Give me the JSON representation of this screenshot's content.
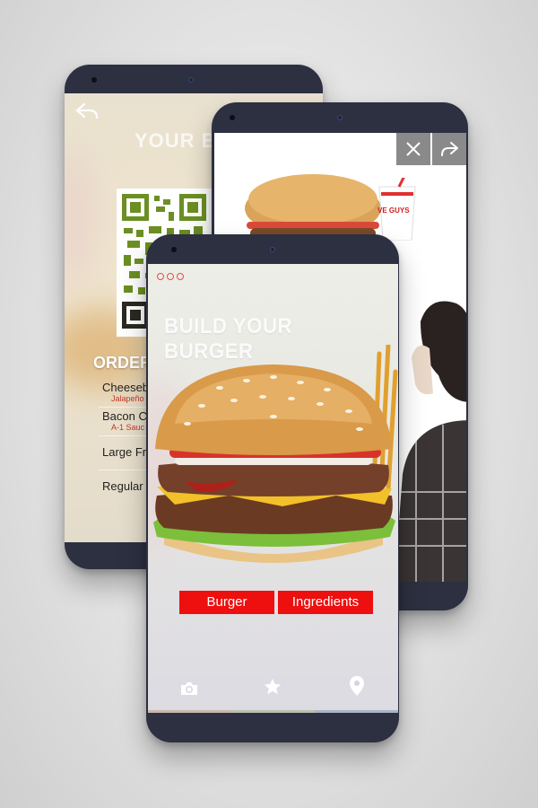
{
  "back_screen": {
    "title": "YOUR B",
    "order_title": "ORDER",
    "items": [
      {
        "name": "Cheeseb",
        "sub": "Jalapeño"
      },
      {
        "name": "Bacon C",
        "sub": "A-1 Sauc"
      },
      {
        "name": "Large Fr",
        "sub": ""
      },
      {
        "name": "Regular",
        "sub": ""
      }
    ],
    "back_icon": "reply-arrow-icon"
  },
  "middle_screen": {
    "close_icon": "close-icon",
    "share_icon": "share-arrow-icon",
    "cup_brand": "VE GUYS"
  },
  "front_screen": {
    "title": "BUILD YOUR BURGER",
    "tabs": [
      {
        "label": "Burger"
      },
      {
        "label": "Ingredients"
      }
    ],
    "bottom_nav": [
      {
        "icon": "camera-icon"
      },
      {
        "icon": "star-icon"
      },
      {
        "icon": "location-pin-icon"
      }
    ]
  },
  "colors": {
    "accent_red": "#ee0f0f",
    "phone_body": "#2c3040",
    "qr_green": "#6b8f22"
  }
}
